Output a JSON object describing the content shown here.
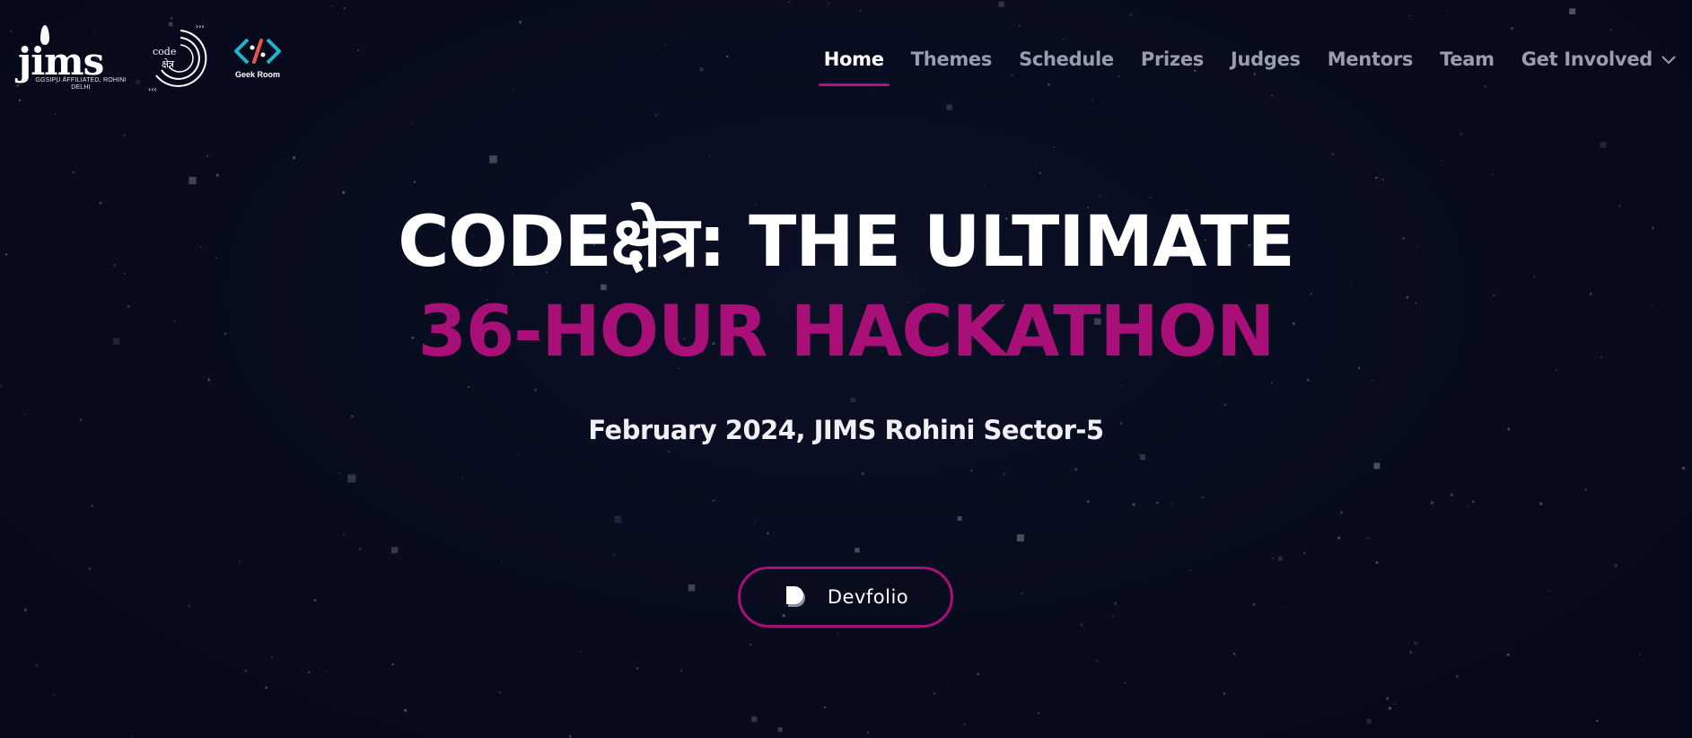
{
  "brand": {
    "jims_wordmark": "jims",
    "jims_subtitle": "GGSIPU AFFILIATED, ROHINI DELHI",
    "code_logo_line1": "code",
    "code_logo_line2": "क्षेत्र",
    "geek_room_label": "Geek Room"
  },
  "nav": {
    "items": [
      {
        "label": "Home",
        "active": true
      },
      {
        "label": "Themes",
        "active": false
      },
      {
        "label": "Schedule",
        "active": false
      },
      {
        "label": "Prizes",
        "active": false
      },
      {
        "label": "Judges",
        "active": false
      },
      {
        "label": "Mentors",
        "active": false
      },
      {
        "label": "Team",
        "active": false
      },
      {
        "label": "Get Involved",
        "active": false,
        "dropdown": true
      }
    ]
  },
  "hero": {
    "line1": "CODEक्षेत्र: THE ULTIMATE",
    "line2": "36-HOUR HACKATHON",
    "subtitle": "February 2024, JIMS Rohini Sector-5"
  },
  "cta": {
    "label": "Devfolio",
    "icon": "devfolio-icon"
  },
  "colors": {
    "background": "#060a1c",
    "accent": "#a80f77",
    "nav_inactive": "#9a9db0",
    "text": "#ffffff"
  }
}
